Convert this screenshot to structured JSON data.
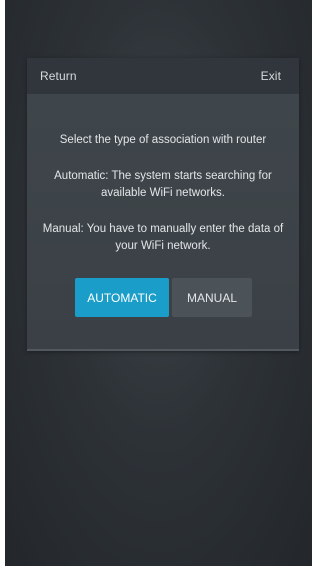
{
  "header": {
    "return_label": "Return",
    "exit_label": "Exit"
  },
  "body": {
    "title": "Select the type of association with router",
    "automatic_description": "Automatic: The system starts searching for available WiFi networks.",
    "manual_description": "Manual: You have to manually enter the data of your WiFi network."
  },
  "buttons": {
    "automatic_label": "AUTOMATIC",
    "manual_label": "MANUAL"
  },
  "colors": {
    "accent": "#1b9dc9",
    "secondary_button": "#4c5358",
    "background": "#2d3237"
  }
}
